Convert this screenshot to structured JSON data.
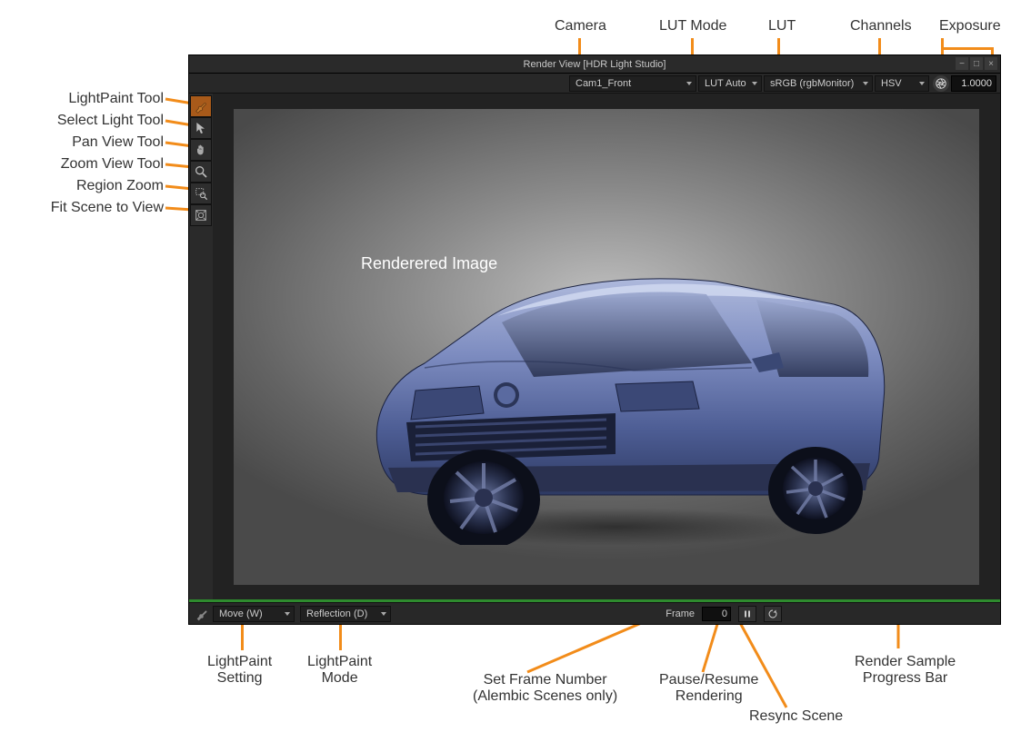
{
  "window": {
    "title": "Render View [HDR Light Studio]"
  },
  "topbar": {
    "camera": "Cam1_Front",
    "lut_mode": "LUT Auto",
    "lut": "sRGB (rgbMonitor)",
    "channels": "HSV",
    "exposure": "1.0000"
  },
  "toolbar": {
    "lightpaint": "brush-icon",
    "select_light": "cursor-icon",
    "pan": "hand-icon",
    "zoom": "magnifier-icon",
    "region_zoom": "region-icon",
    "fit": "fit-icon"
  },
  "viewport": {
    "render_label": "Renderered Image"
  },
  "bottombar": {
    "lightpaint_setting": "Move (W)",
    "lightpaint_mode": "Reflection (D)",
    "frame_label": "Frame",
    "frame_number": "0",
    "pause": "pause-icon",
    "resync": "resync-icon"
  },
  "annotations": {
    "top": {
      "camera": "Camera",
      "lut_mode": "LUT Mode",
      "lut": "LUT",
      "channels": "Channels",
      "exposure": "Exposure"
    },
    "left": {
      "lightpaint": "LightPaint Tool",
      "select": "Select Light Tool",
      "pan": "Pan View Tool",
      "zoom": "Zoom View Tool",
      "region": "Region Zoom",
      "fit": "Fit Scene to View"
    },
    "bottom": {
      "lp_setting": "LightPaint\nSetting",
      "lp_mode": "LightPaint\nMode",
      "frame": "Set Frame Number\n(Alembic Scenes only)",
      "pause": "Pause/Resume\nRendering",
      "resync": "Resync Scene",
      "progress": "Render Sample\nProgress Bar"
    }
  }
}
